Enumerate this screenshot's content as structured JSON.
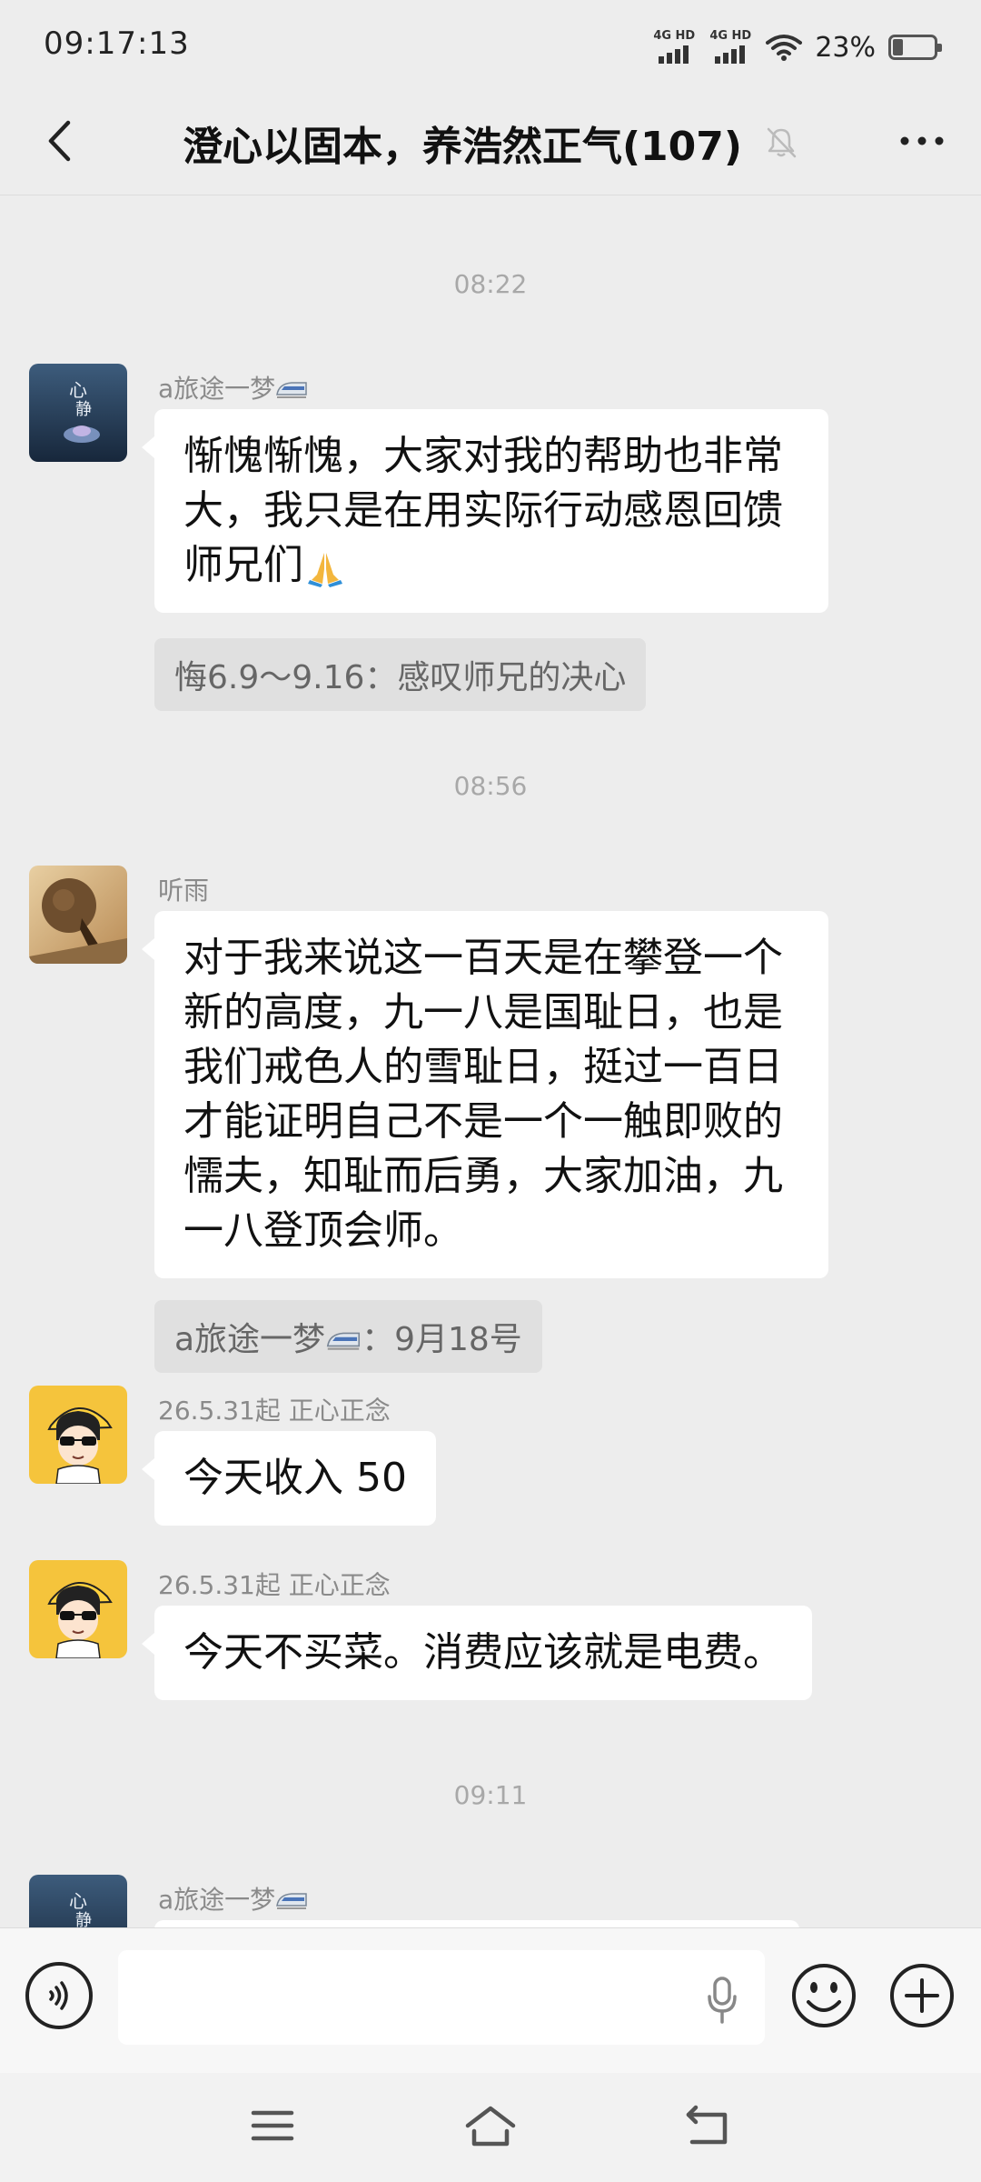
{
  "status": {
    "time": "09:17:13",
    "net1": "4G HD",
    "net2": "4G HD",
    "battery": "23%"
  },
  "header": {
    "title": "澄心以固本，养浩然正气(107)"
  },
  "messages": {
    "t1": "08:22",
    "m1": {
      "sender": "a旅途一梦",
      "text_a": "惭愧惭愧，大家对我的帮助也非常",
      "text_b": "大，我只是在用实际行动感恩回馈",
      "text_c": "师兄们",
      "quote": "悔6.9～9.16：感叹师兄的决心"
    },
    "t2": "08:56",
    "m2": {
      "sender": "听雨",
      "lines": [
        "对于我来说这一百天是在攀登一个",
        "新的高度，九一八是国耻日，也是",
        "我们戒色人的雪耻日，挺过一百日",
        "才能证明自己不是一个一触即败的",
        "懦夫，知耻而后勇，大家加油，九",
        "一八登顶会师。"
      ],
      "quote_name": "a旅途一梦",
      "quote_text": "：9月18号"
    },
    "m3": {
      "sender": "26.5.31起 正心正念",
      "text": "今天收入 50"
    },
    "m4": {
      "sender": "26.5.31起 正心正念",
      "text": "今天不买菜。消费应该就是电费。"
    },
    "t3": "09:11",
    "m5": {
      "sender": "a旅途一梦"
    }
  },
  "input": {
    "value": "",
    "placeholder": ""
  },
  "colors": {
    "bg": "#ededed",
    "bubble": "#ffffff",
    "quote": "#e0e0e0"
  }
}
